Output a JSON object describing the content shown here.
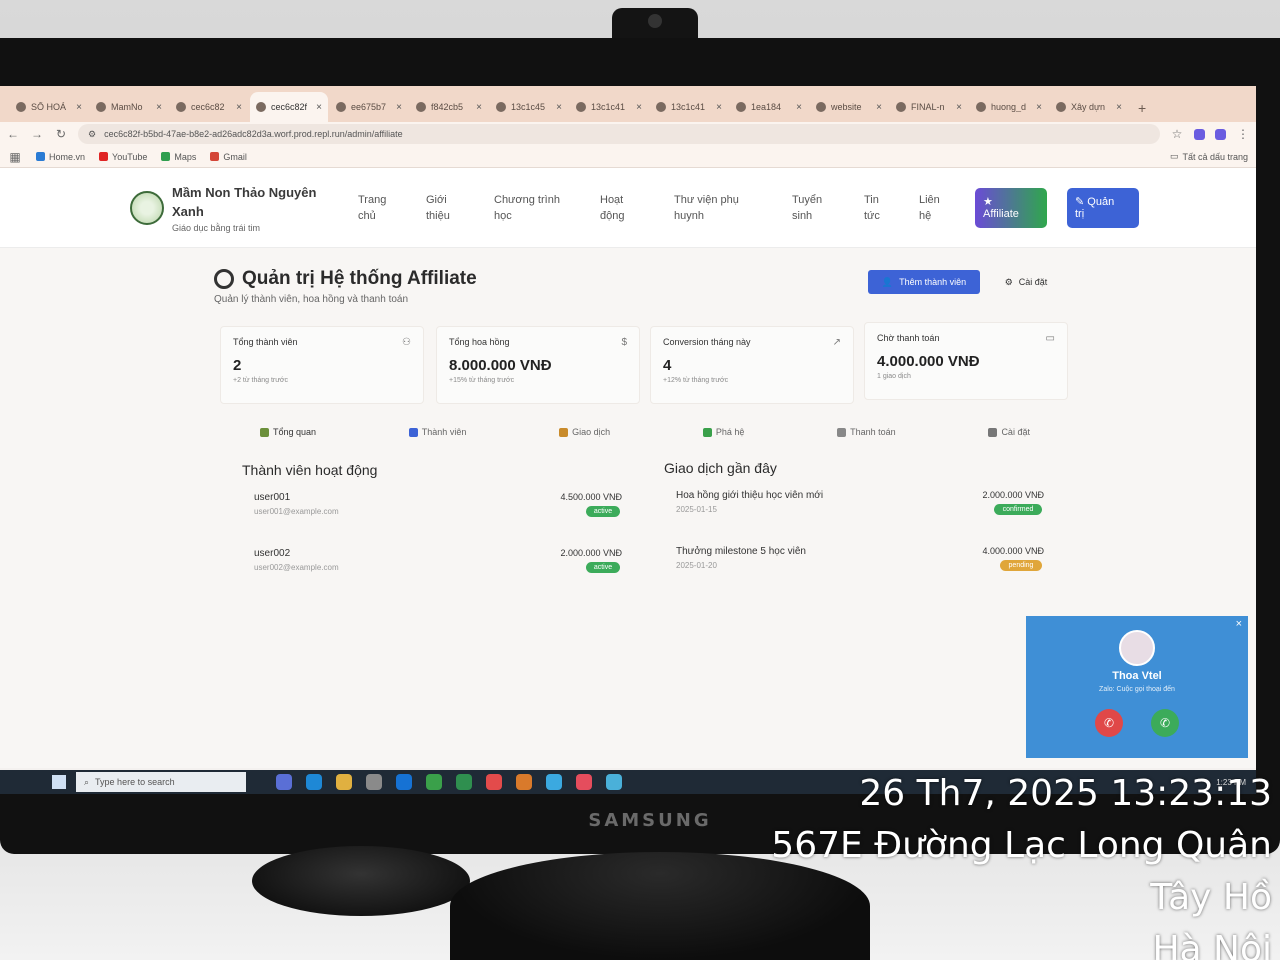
{
  "browser": {
    "tabs": [
      {
        "title": "SỔ HOÁ",
        "active": false
      },
      {
        "title": "MamNo",
        "active": false
      },
      {
        "title": "cec6c82",
        "active": false
      },
      {
        "title": "cec6c82f",
        "active": true
      },
      {
        "title": "ee675b7",
        "active": false
      },
      {
        "title": "f842cb5",
        "active": false
      },
      {
        "title": "13c1c45",
        "active": false
      },
      {
        "title": "13c1c41",
        "active": false
      },
      {
        "title": "13c1c41",
        "active": false
      },
      {
        "title": "1ea184",
        "active": false
      },
      {
        "title": "website",
        "active": false
      },
      {
        "title": "FINAL-n",
        "active": false
      },
      {
        "title": "huong_d",
        "active": false
      },
      {
        "title": "Xây dựn",
        "active": false
      }
    ],
    "new_tab": "+",
    "url": "cec6c82f-b5bd-47ae-b8e2-ad26adc82d3a.worf.prod.repl.run/admin/affiliate",
    "bookmarks": [
      {
        "label": "Home.vn",
        "color": "#2a7bd4"
      },
      {
        "label": "YouTube",
        "color": "#e02424"
      },
      {
        "label": "Maps",
        "color": "#2f9e4f"
      },
      {
        "label": "Gmail",
        "color": "#d44638"
      }
    ],
    "bookmarks_all": "Tất cả dấu trang"
  },
  "site": {
    "name_line1": "Mầm Non Thảo Nguyên",
    "name_line2": "Xanh",
    "tagline": "Giáo dục bằng trái tim",
    "nav": [
      {
        "label": "Trang\nchủ"
      },
      {
        "label": "Giới\nthiệu"
      },
      {
        "label": "Chương trình\nhọc"
      },
      {
        "label": "Hoạt\nđộng"
      },
      {
        "label": "Thư viện phụ\nhuynh"
      },
      {
        "label": "Tuyển\nsinh"
      },
      {
        "label": "Tin\ntức"
      },
      {
        "label": "Liên\nhệ"
      }
    ],
    "affiliate_btn": {
      "icon": "★",
      "label": "Affiliate"
    },
    "admin_btn": {
      "icon": "✎",
      "label": "Quản\ntrị"
    }
  },
  "dashboard": {
    "title": "Quản trị Hệ thống Affiliate",
    "subtitle": "Quản lý thành viên, hoa hồng và thanh toán",
    "add_member": "Thêm thành viên",
    "settings": "Cài đặt",
    "stats": [
      {
        "label": "Tổng thành viên",
        "value": "2",
        "note": "+2 từ tháng trước",
        "icon": "👥"
      },
      {
        "label": "Tổng hoa hồng",
        "value": "8.000.000 VNĐ",
        "note": "+15% từ tháng trước",
        "icon": "$"
      },
      {
        "label": "Conversion tháng này",
        "value": "4",
        "note": "+12% từ tháng trước",
        "icon": "↗"
      },
      {
        "label": "Chờ thanh toán",
        "value": "4.000.000 VNĐ",
        "note": "1 giao dịch",
        "icon": "▭"
      }
    ],
    "tabs": [
      {
        "label": "Tổng quan",
        "color": "#6b8f3a"
      },
      {
        "label": "Thành viên",
        "color": "#3d63d6"
      },
      {
        "label": "Giao dịch",
        "color": "#c98b2b"
      },
      {
        "label": "Phá hệ",
        "color": "#3aa04a"
      },
      {
        "label": "Thanh toán",
        "color": "#888888"
      },
      {
        "label": "Cài đặt",
        "color": "#777777"
      }
    ],
    "members_title": "Thành viên hoạt động",
    "members": [
      {
        "name": "user001",
        "email": "user001@example.com",
        "amount": "4.500.000 VNĐ",
        "status": "active"
      },
      {
        "name": "user002",
        "email": "user002@example.com",
        "amount": "2.000.000 VNĐ",
        "status": "active"
      }
    ],
    "transactions_title": "Giao dịch gần đây",
    "transactions": [
      {
        "desc": "Hoa hồng giới thiệu học viên mới",
        "date": "2025-01-15",
        "amount": "2.000.000 VNĐ",
        "status": "confirmed"
      },
      {
        "desc": "Thưởng milestone 5 học viên",
        "date": "2025-01-20",
        "amount": "4.000.000 VNĐ",
        "status": "pending"
      }
    ],
    "status_colors": {
      "active": "#3cab5a",
      "confirmed": "#3cab5a",
      "pending": "#e0a63a"
    }
  },
  "taskbar": {
    "search_placeholder": "Type here to search",
    "apps": [
      "#5a6fd6",
      "#1e88d6",
      "#e0b040",
      "#8a8a8a",
      "#1672d4",
      "#3aa04a",
      "#2f8f4f",
      "#e34b4b",
      "#d97a2b",
      "#3ba9e0",
      "#e54d5d",
      "#4ab0d9"
    ],
    "tray_time": "1:23 PM"
  },
  "call": {
    "close": "×",
    "caller": "Thoa Vtel",
    "status": "Zalo: Cuộc gọi thoại đến",
    "decline_icon": "✆",
    "accept_icon": "✆"
  },
  "monitor": {
    "brand": "SAMSUNG"
  },
  "stamp": {
    "datetime": "26 Th7, 2025 13:23:13",
    "line2": "567E Đường Lạc Long Quân",
    "line3": "Tây Hồ",
    "line4": "Hà Nội"
  }
}
